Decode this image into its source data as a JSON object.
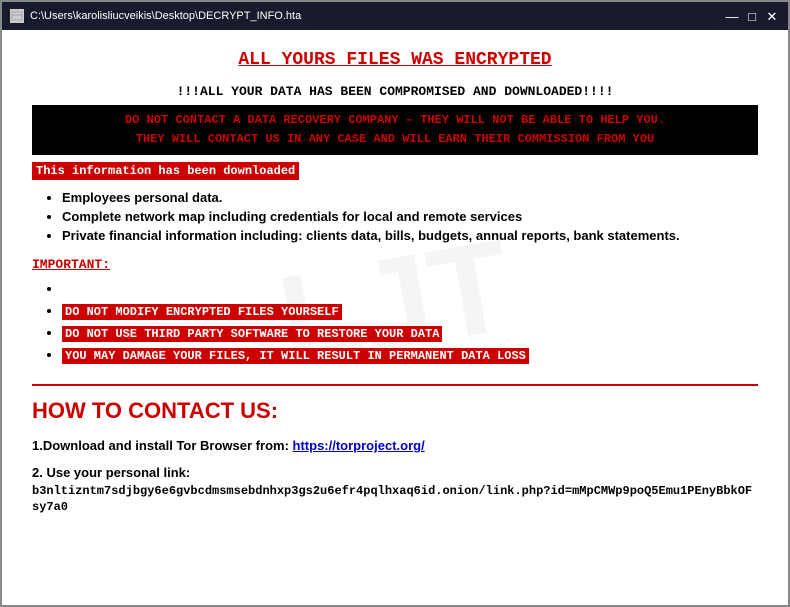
{
  "window": {
    "title": "C:\\Users\\karolisliucveikis\\Desktop\\DECRYPT_INFO.hta",
    "icon": "📄"
  },
  "titlebar": {
    "minimize": "—",
    "maximize": "□",
    "close": "✕"
  },
  "content": {
    "main_title": "ALL YOURS FILES WAS ENCRYPTED",
    "subtitle": "!!!ALL YOUR DATA HAS BEEN COMPROMISED AND DOWNLOADED!!!!",
    "red_block_line1": "DO NOT CONTACT A DATA RECOVERY COMPANY – THEY WILL NOT BE ABLE TO HELP YOU.",
    "red_block_line2": "THEY WILL CONTACT US IN ANY CASE AND WILL EARN THEIR COMMISSION FROM YOU",
    "downloaded_label": "This information has been downloaded",
    "data_items": [
      "Employees personal data.",
      "Complete network map including credentials for local and remote services",
      "Private financial information including: clients data, bills, budgets, annual reports, bank statements."
    ],
    "important_label": "IMPORTANT:",
    "warning_items": [
      "",
      "DO NOT MODIFY ENCRYPTED FILES YOURSELF",
      "DO NOT USE THIRD PARTY SOFTWARE TO RESTORE YOUR DATA",
      "YOU MAY DAMAGE YOUR FILES, IT WILL RESULT IN PERMANENT DATA LOSS"
    ],
    "contact_title": "HOW TO CONTACT US:",
    "step1_label": "1.Download and install Tor Browser from:",
    "step1_link_text": "https://torproject.org/",
    "step1_link_href": "https://torproject.org/",
    "step2_label": "2. Use your personal link:",
    "step2_link": "b3nltizntm7sdjbgy6e6gvbcdmsmsebdnhxp3gs2u6efr4pqlhxaq6id.onion/link.php?id=mMpCMWp9poQ5Emu1PEnyBbkOFsy7a0",
    "watermark": "LJT"
  }
}
